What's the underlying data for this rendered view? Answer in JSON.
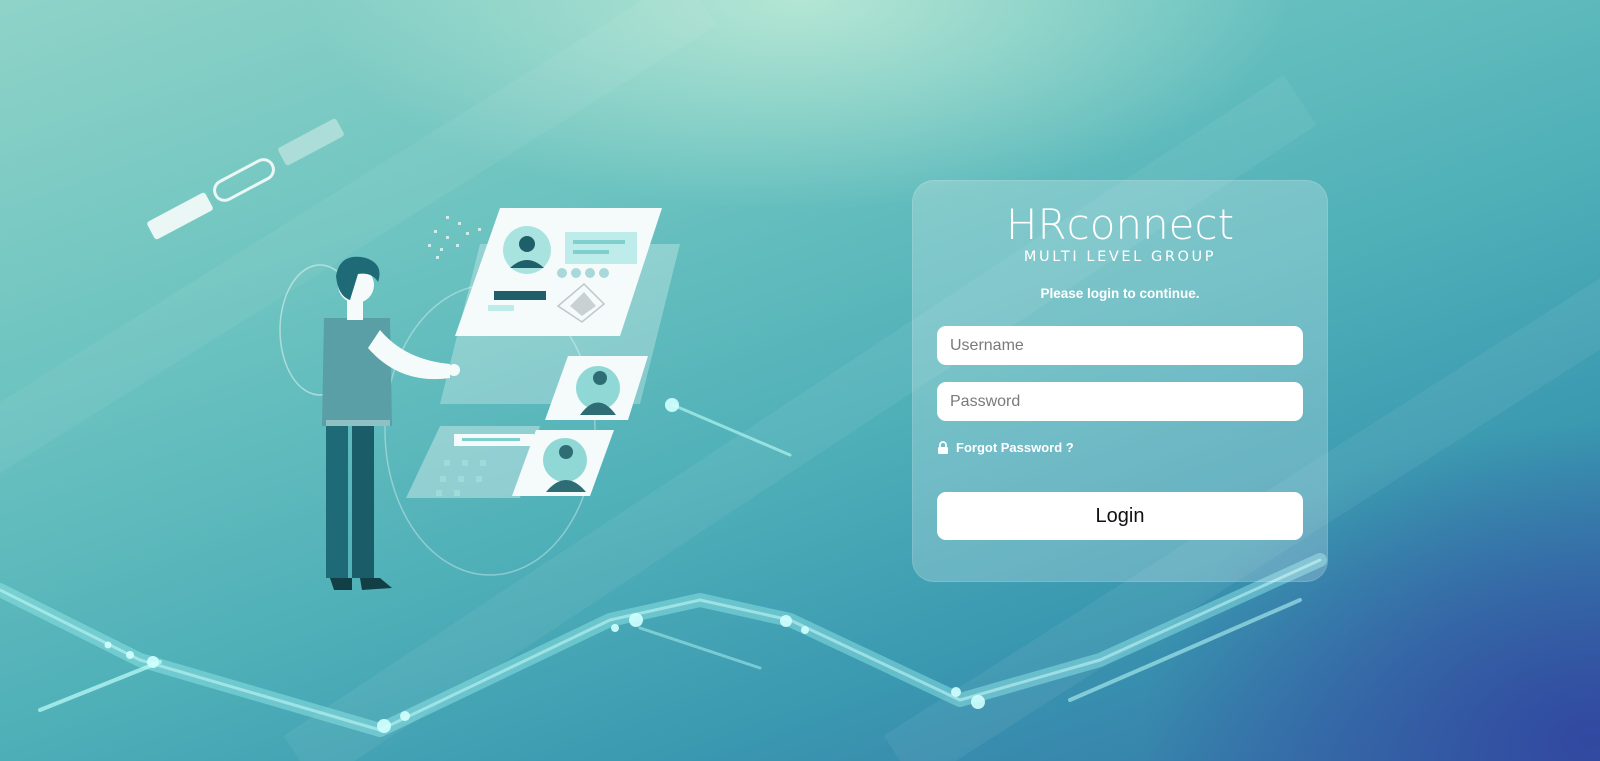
{
  "brand": {
    "logo_mark": "HRconnect",
    "logo_sub": "MULTI LEVEL GROUP"
  },
  "login": {
    "prompt": "Please login to continue.",
    "username_placeholder": "Username",
    "password_placeholder": "Password",
    "forgot_label": "Forgot Password ?",
    "login_label": "Login"
  },
  "icons": {
    "forgot": "lock-icon"
  },
  "colors": {
    "card_bg": "rgba(255,255,255,0.22)",
    "text_on_card": "#ffffff",
    "button_bg": "#ffffff"
  }
}
